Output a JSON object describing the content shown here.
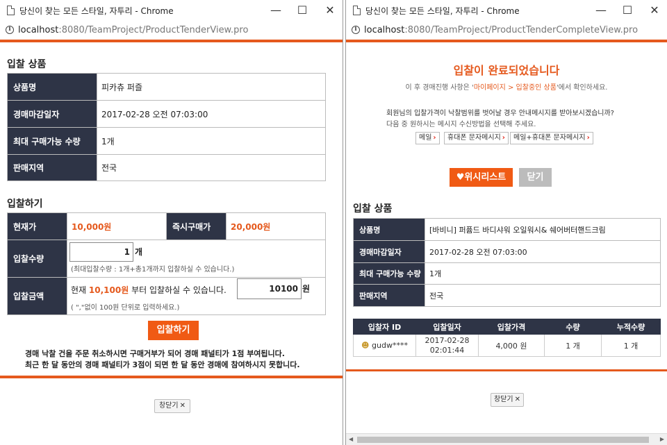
{
  "left": {
    "window_title": "당신이 찾는 모든 스타일, 자투리 - Chrome",
    "url_host": "localhost",
    "url_path": ":8080/TeamProject/ProductTenderView.pro",
    "product_section_title": "입찰 상품",
    "product_rows": [
      {
        "label": "상품명",
        "value": "피카츄 퍼즐"
      },
      {
        "label": "경매마감일자",
        "value": "2017-02-28 오전 07:03:00"
      },
      {
        "label": "최대 구매가능 수량",
        "value": "1개"
      },
      {
        "label": "판매지역",
        "value": "전국"
      }
    ],
    "bid_section_title": "입찰하기",
    "current_price_label": "현재가",
    "current_price_value": "10,000원",
    "instant_price_label": "즉시구매가",
    "instant_price_value": "20,000원",
    "qty_label": "입찰수량",
    "qty_value": "1",
    "qty_unit": "개",
    "qty_note": "(최대입찰수량 : 1개+총1개까지 입찰하실 수 있습니다.)",
    "amount_label": "입찰금액",
    "amount_prefix": "현재",
    "amount_min": "10,100원",
    "amount_suffix": "부터 입찰하실 수 있습니다.",
    "amount_value": "10100",
    "amount_unit": "원",
    "amount_note": "( \",\"없이 100원 단위로 입력하세요.)",
    "bid_button": "입찰하기",
    "penalty_line1": "경매 낙찰 건을 주문 취소하시면 구매거부가 되어 경매 패널티가 1점 부여됩니다.",
    "penalty_line2": "최근 한 달 동안의 경매 패널티가 3점이 되면 한 달 동안 경매에 참여하시지 못합니다.",
    "close_button": "창닫기"
  },
  "right": {
    "window_title": "당신이 찾는 모든 스타일, 자투리 - Chrome",
    "url_host": "localhost",
    "url_path": ":8080/TeamProject/ProductTenderCompleteView.pro",
    "complete_title": "입찰이 완료되었습니다",
    "complete_sub_prefix": "이 후 경매진행 사항은 '",
    "complete_sub_link": "마이페이지 > 입찰중인 상품",
    "complete_sub_suffix": "'에서 확인하세요.",
    "notice_line1": "회원님의 입찰가격이 낙찰범위를 벗어날 경우 안내메시지를 받아보시겠습니까?",
    "notice_line2": "다음 중 원하시는 메시지 수신방법을 선택해 주세요.",
    "msg_buttons": [
      "메일",
      "휴대폰 문자메시지",
      "메일+휴대폰 문자메시지"
    ],
    "wishlist_button": "♥위시리스트",
    "close_gray_button": "닫기",
    "product_section_title": "입찰 상품",
    "product_rows": [
      {
        "label": "상품명",
        "value": "[바비니] 퍼퓸드 바디샤워 오일워시& 쉐어버터핸드크림"
      },
      {
        "label": "경매마감일자",
        "value": "2017-02-28 오전 07:03:00"
      },
      {
        "label": "최대 구매가능 수량",
        "value": "1개"
      },
      {
        "label": "판매지역",
        "value": "전국"
      }
    ],
    "bid_table": {
      "headers": [
        "입찰자 ID",
        "입찰일자",
        "입찰가격",
        "수량",
        "누적수량"
      ],
      "rows": [
        {
          "id": "gudw****",
          "date1": "2017-02-28",
          "date2": "02:01:44",
          "price": "4,000 원",
          "qty": "1 개",
          "cum": "1 개"
        }
      ]
    },
    "close_button": "창닫기"
  },
  "colors": {
    "accent": "#e5591d",
    "header_bg": "#2e3446",
    "button": "#f05a14"
  }
}
